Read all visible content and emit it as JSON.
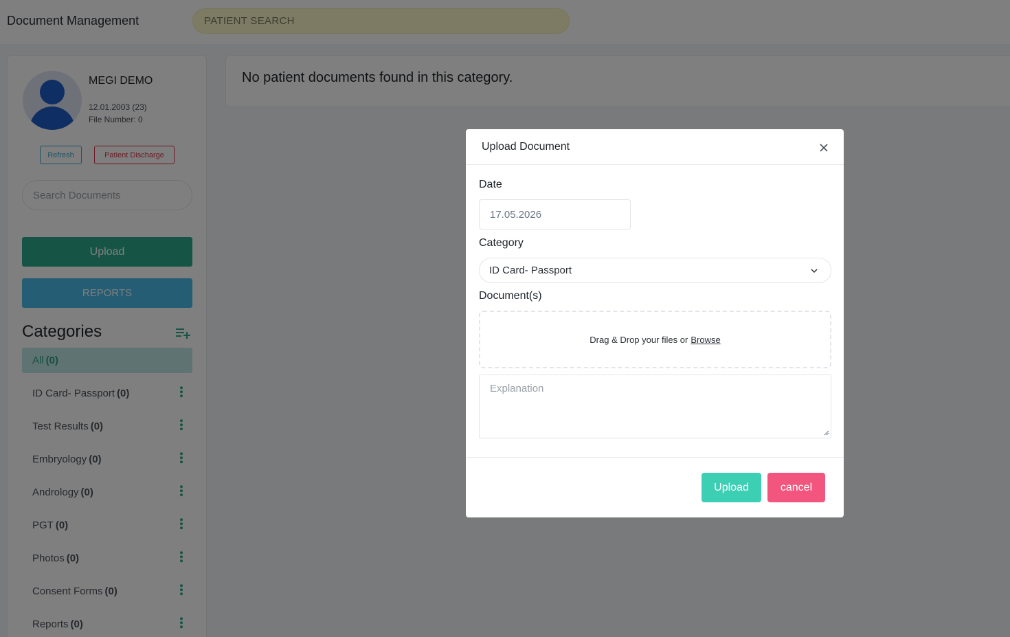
{
  "header": {
    "title": "Document Management",
    "patient_search_placeholder": "PATIENT SEARCH"
  },
  "patient": {
    "name": "MEGI DEMO",
    "dob": "12.01.2003 (23)",
    "file_number": "File Number: 0",
    "refresh_label": "Refresh",
    "discharge_label": "Patient Discharge"
  },
  "sidebar": {
    "search_placeholder": "Search Documents",
    "upload_label": "Upload",
    "reports_label": "REPORTS",
    "categories_heading": "Categories",
    "categories": [
      {
        "label": "All",
        "count": "(0)"
      },
      {
        "label": "ID Card- Passport",
        "count": "(0)"
      },
      {
        "label": "Test Results",
        "count": "(0)"
      },
      {
        "label": "Embryology",
        "count": "(0)"
      },
      {
        "label": "Andrology",
        "count": "(0)"
      },
      {
        "label": "PGT",
        "count": "(0)"
      },
      {
        "label": "Photos",
        "count": "(0)"
      },
      {
        "label": "Consent Forms",
        "count": "(0)"
      },
      {
        "label": "Reports",
        "count": "(0)"
      }
    ]
  },
  "main": {
    "empty_message": "No patient documents found in this category."
  },
  "modal": {
    "title": "Upload Document",
    "date_label": "Date",
    "date_value": "17.05.2026",
    "category_label": "Category",
    "category_value": "ID Card- Passport",
    "documents_label": "Document(s)",
    "dropzone_text": "Drag & Drop your files or",
    "browse_label": "Browse",
    "explanation_placeholder": "Explanation",
    "upload_label": "Upload",
    "cancel_label": "cancel"
  },
  "colors": {
    "upload_green": "#2cab8c",
    "reports_blue": "#4bbbe8",
    "modal_upload": "#3ccfb4",
    "cancel_pink": "#f2557e",
    "discharge_red": "#d8334a",
    "active_category_bg": "#bfe6e6"
  }
}
